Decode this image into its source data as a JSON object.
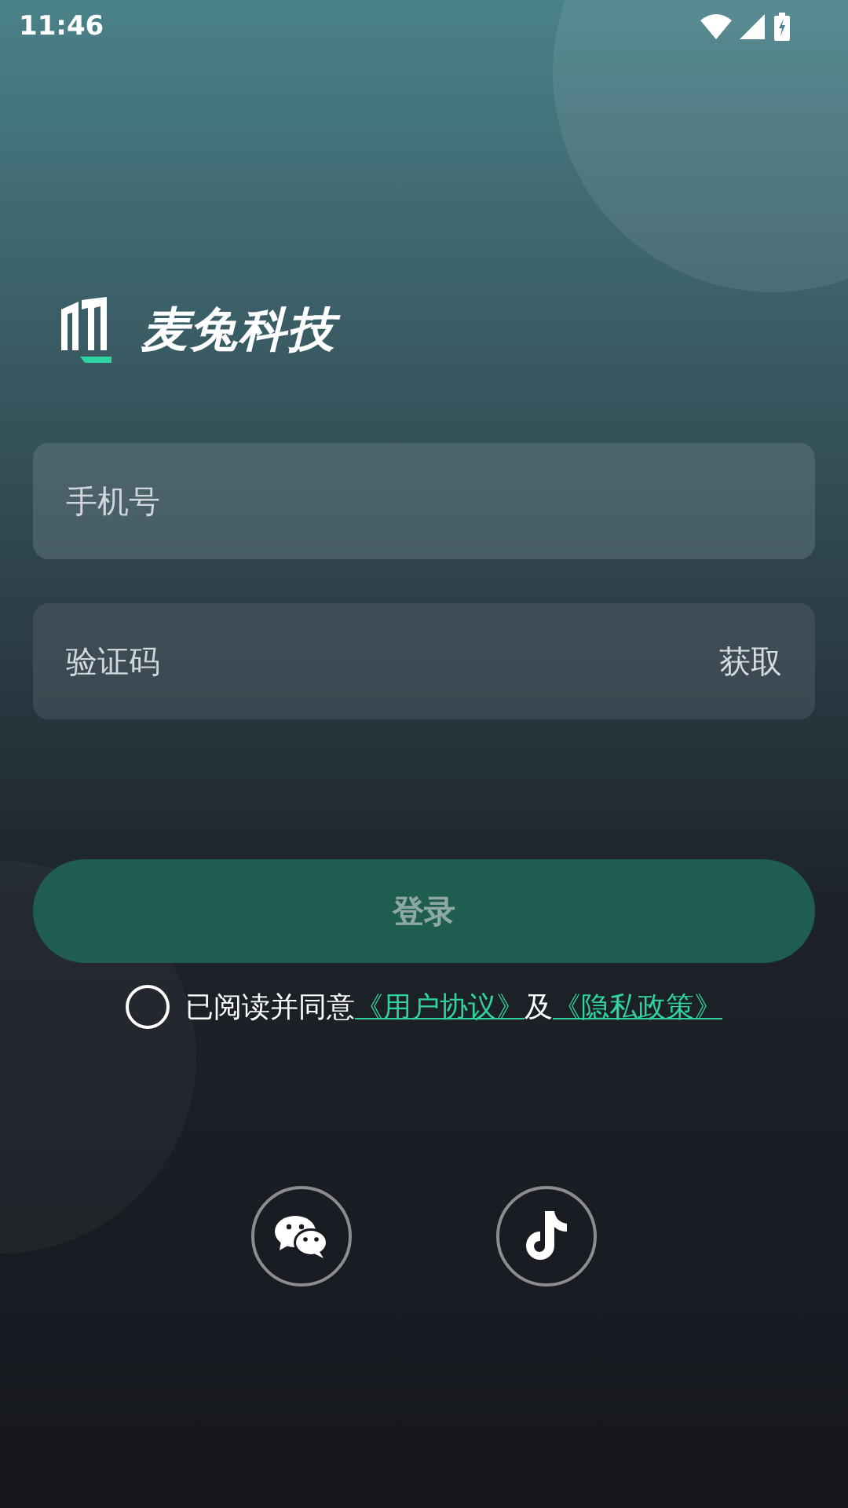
{
  "status_bar": {
    "time": "11:46"
  },
  "brand": {
    "name": "麦兔科技"
  },
  "phone_field": {
    "placeholder": "手机号"
  },
  "code_field": {
    "placeholder": "验证码",
    "action": "获取"
  },
  "login_button": {
    "label": "登录"
  },
  "agreement": {
    "checked": false,
    "text": "已阅读并同意",
    "link_1": "《用户协议》",
    "joiner": "及",
    "link_2": "《隐私政策》"
  },
  "social_logins": [
    {
      "kind": "chat"
    },
    {
      "kind": "note"
    }
  ]
}
